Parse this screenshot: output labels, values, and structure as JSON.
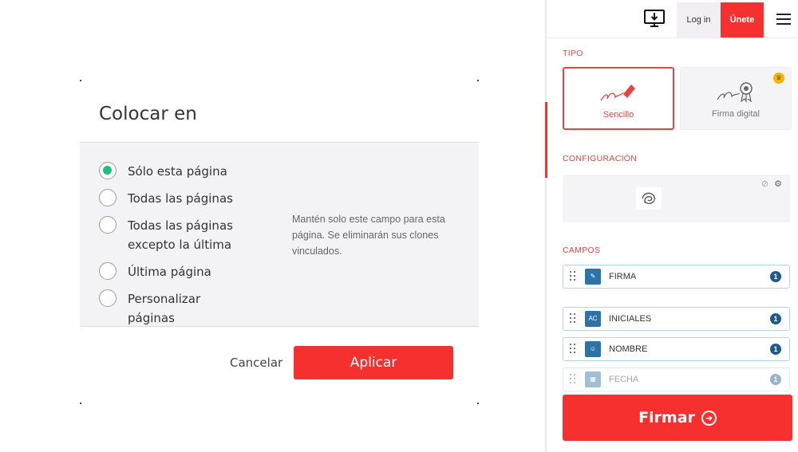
{
  "modal": {
    "title": "Colocar en",
    "options": [
      {
        "label": "Sólo esta página",
        "checked": true
      },
      {
        "label": "Todas las páginas",
        "checked": false
      },
      {
        "label": "Todas las páginas excepto la última",
        "checked": false
      },
      {
        "label": "Última página",
        "checked": false
      },
      {
        "label": "Personalizar páginas",
        "checked": false
      }
    ],
    "hint": "Mantén solo este campo para esta página. Se eliminarán sus clones vinculados.",
    "cancel_label": "Cancelar",
    "apply_label": "Aplicar",
    "accent_color": "#f6302f",
    "radio_checked_color": "#22c07b"
  },
  "panel": {
    "header": {
      "login_label": "Log in",
      "join_label": "Únete",
      "icons": [
        "desktop-download-icon",
        "hamburger-menu-icon"
      ]
    },
    "tipo": {
      "section_label": "TIPO",
      "cards": [
        {
          "label": "Sencillo",
          "selected": true,
          "icon": "pen-signature-icon"
        },
        {
          "label": "Firma digital",
          "selected": false,
          "icon": "certificate-signature-icon",
          "premium": true
        }
      ]
    },
    "config": {
      "section_label": "CONFIGURACIÓN",
      "icons": [
        "eraser-icon",
        "gear-icon"
      ]
    },
    "campos": {
      "section_label": "CAMPOS",
      "fields": [
        {
          "name": "FIRMA",
          "count": "1",
          "icon": "signature-field-icon"
        },
        {
          "name": "INICIALES",
          "count": "1",
          "icon": "initials-field-icon"
        },
        {
          "name": "NOMBRE",
          "count": "1",
          "icon": "name-field-icon"
        },
        {
          "name": "FECHA",
          "count": "1",
          "icon": "date-field-icon"
        }
      ]
    },
    "sign_button_label": "Firmar",
    "accent_color": "#e5453e",
    "field_icon_color": "#2d72a8"
  }
}
